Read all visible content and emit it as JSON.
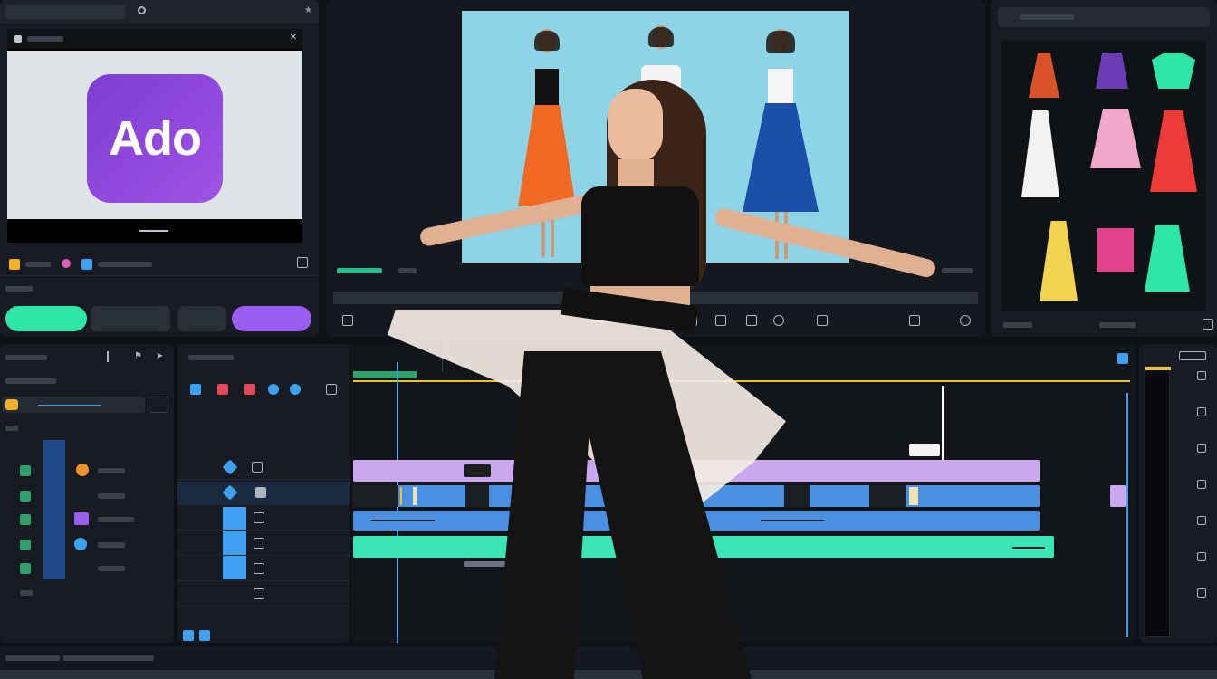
{
  "left_panel": {
    "tab_label": "",
    "preview_logo": "Ado",
    "bottom_buttons": [
      "",
      "",
      "",
      ""
    ]
  },
  "center_preview": {
    "caption": "",
    "overlay_text": ""
  },
  "right_panel": {
    "search_placeholder": ""
  },
  "timeline": {
    "marker_label": ""
  },
  "colors": {
    "accent_green": "#2ee6a6",
    "accent_purple": "#9b5cf2",
    "clip_lavender": "#c9a8f0",
    "clip_blue": "#4a8fe0",
    "clip_teal": "#39e6b4",
    "playhead_yellow": "#f2c230"
  },
  "icons": [
    "bolt-icon",
    "lock-icon",
    "eye-icon",
    "gear-icon",
    "refresh-icon",
    "scissors-icon",
    "pin-icon"
  ]
}
